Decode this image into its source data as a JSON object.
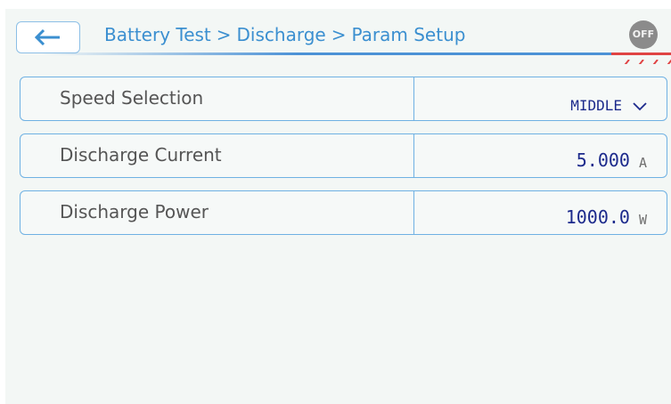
{
  "header": {
    "breadcrumb": [
      "Battery Test",
      "Discharge",
      "Param Setup"
    ],
    "separator": ">",
    "status_badge": "OFF"
  },
  "params": [
    {
      "label": "Speed Selection",
      "value": "MIDDLE",
      "unit": "",
      "type": "dropdown"
    },
    {
      "label": "Discharge Current",
      "value": "5.000",
      "unit": "A",
      "type": "number"
    },
    {
      "label": "Discharge Power",
      "value": "1000.0",
      "unit": "W",
      "type": "number"
    }
  ],
  "colors": {
    "accent": "#3b8fd0",
    "border": "#6fb1e3",
    "value": "#1c2a8c",
    "alert": "#e04444",
    "background": "#f3f7f5"
  },
  "icons": [
    "back-arrow-icon",
    "chevron-down-icon"
  ]
}
